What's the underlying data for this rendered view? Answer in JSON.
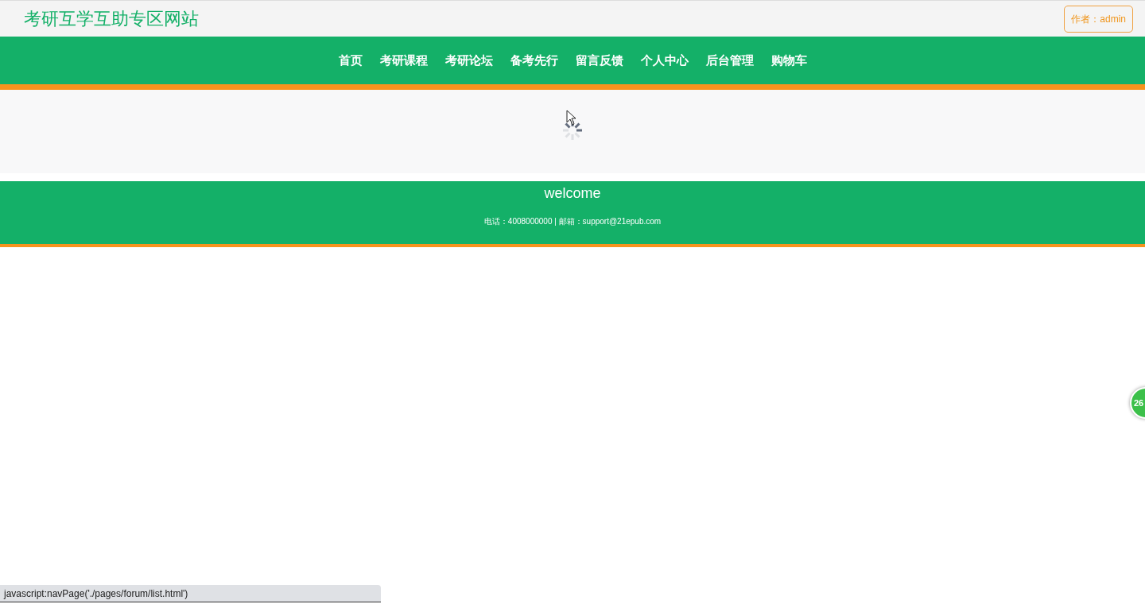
{
  "header": {
    "site_title": "考研互学互助专区网站",
    "author_badge": "作者：admin"
  },
  "nav": [
    {
      "label": "首页"
    },
    {
      "label": "考研课程"
    },
    {
      "label": "考研论坛"
    },
    {
      "label": "备考先行"
    },
    {
      "label": "留言反馈"
    },
    {
      "label": "个人中心"
    },
    {
      "label": "后台管理"
    },
    {
      "label": "购物车"
    }
  ],
  "footer": {
    "title": "welcome",
    "contact": "电话：4008000000 | 邮箱：support@21epub.com"
  },
  "floating_badge": "26",
  "status_bar": "javascript:navPage('./pages/forum/list.html')"
}
